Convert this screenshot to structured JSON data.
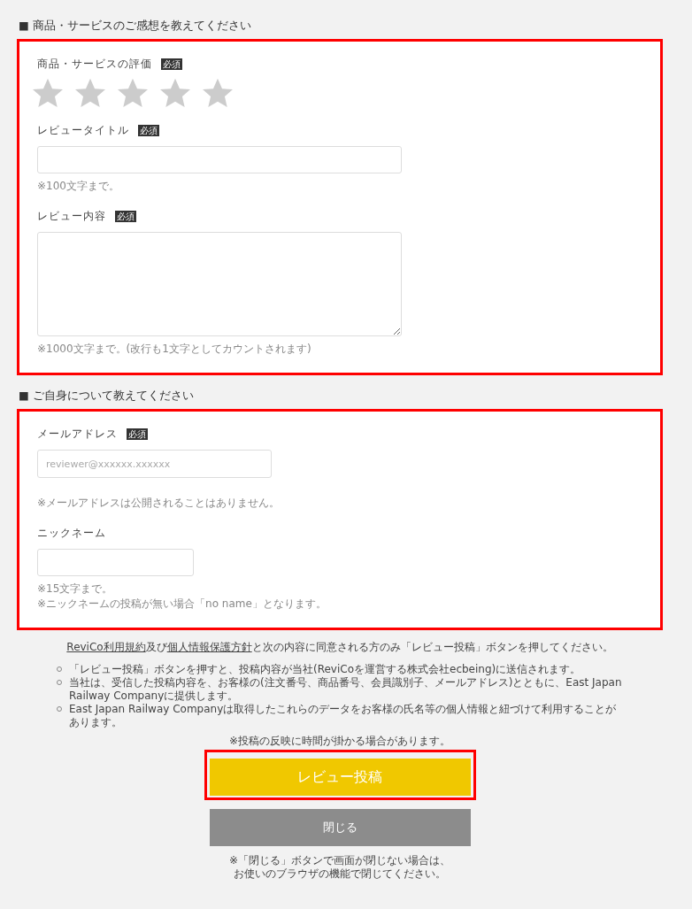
{
  "sections": [
    {
      "heading": "■ 商品・サービスのご感想を教えてください",
      "highlighted": true,
      "fields": [
        {
          "kind": "rating",
          "label": "商品・サービスの評価",
          "badge": "必須",
          "stars": 0
        },
        {
          "kind": "text",
          "label": "レビュータイトル",
          "badge": "必須",
          "notes": [
            "※100文字まで。"
          ]
        },
        {
          "kind": "textarea",
          "label": "レビュー内容",
          "badge": "必須",
          "notes": [
            "※1000文字まで。(改行も1文字としてカウントされます)"
          ]
        }
      ]
    },
    {
      "heading": "■ ご自身について教えてください",
      "highlighted": true,
      "fields": [
        {
          "kind": "email",
          "label": "メールアドレス",
          "badge": "必須",
          "placeholder": "reviewer@xxxxxx.xxxxxx",
          "notes": [
            "※メールアドレスは公開されることはありません。"
          ]
        },
        {
          "kind": "short",
          "label": "ニックネーム",
          "notes": [
            "※15文字まで。",
            "※ニックネームの投稿が無い場合「no name」となります。"
          ]
        }
      ]
    }
  ],
  "agreement": [
    {
      "kind": "link",
      "text": "ReviCo利用規約"
    },
    {
      "kind": "text",
      "text": "及び"
    },
    {
      "kind": "link",
      "text": "個人情報保護方針"
    },
    {
      "kind": "text",
      "text": "と次の内容に同意される方のみ「レビュー投稿」ボタンを押してください。"
    }
  ],
  "terms": [
    "「レビュー投稿」ボタンを押すと、投稿内容が当社(ReviCoを運営する株式会社ecbeing)に送信されます。",
    "当社は、受信した投稿内容を、お客様の(注文番号、商品番号、会員識別子、メールアドレス)とともに、East Japan Railway Companyに提供します。",
    "East Japan Railway Companyは取得したこれらのデータをお客様の氏名等の個人情報と紐づけて利用することがあります。"
  ],
  "delay_note": "※投稿の反映に時間が掛かる場合があります。",
  "buttons": [
    {
      "kind": "primary",
      "label": "レビュー投稿",
      "highlighted": true
    },
    {
      "kind": "secondary",
      "label": "閉じる",
      "highlighted": false
    }
  ],
  "close_notes": [
    "※「閉じる」ボタンで画面が閉じない場合は、",
    "お使いのブラウザの機能で閉じてください。"
  ]
}
